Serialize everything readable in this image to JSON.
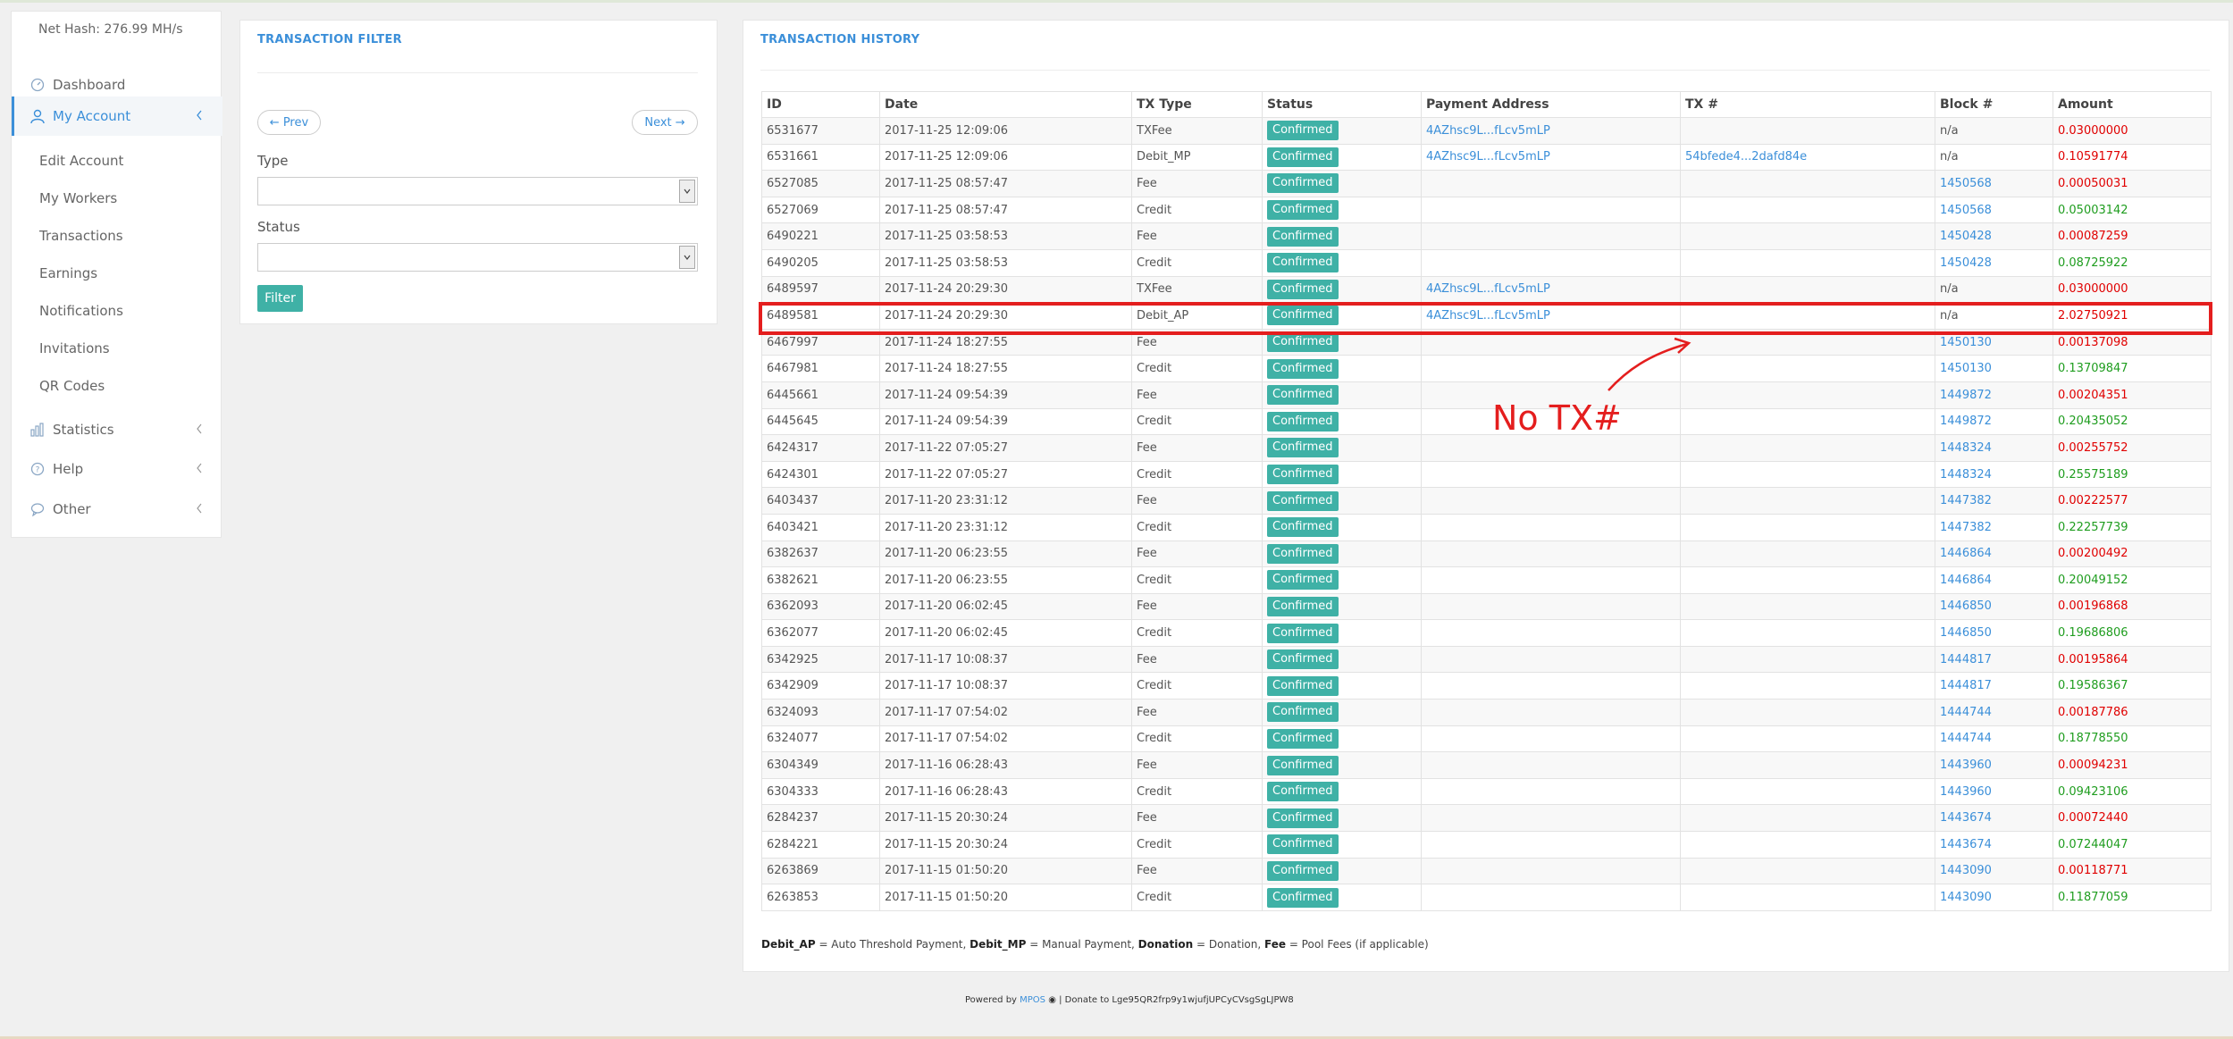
{
  "sidebar": {
    "net_hash": "Net Hash: 276.99 MH/s",
    "dashboard": "Dashboard",
    "my_account": "My Account",
    "sub_items": [
      "Edit Account",
      "My Workers",
      "Transactions",
      "Earnings",
      "Notifications",
      "Invitations",
      "QR Codes"
    ],
    "statistics": "Statistics",
    "help": "Help",
    "other": "Other"
  },
  "filter": {
    "title": "TRANSACTION FILTER",
    "prev": "← Prev",
    "next": "Next →",
    "type_label": "Type",
    "status_label": "Status",
    "filter_button": "Filter"
  },
  "history": {
    "title": "TRANSACTION HISTORY",
    "columns": [
      "ID",
      "Date",
      "TX Type",
      "Status",
      "Payment Address",
      "TX #",
      "Block #",
      "Amount"
    ],
    "rows": [
      {
        "id": "6531677",
        "date": "2017-11-25 12:09:06",
        "type": "TXFee",
        "status": "Confirmed",
        "address": "4AZhsc9L...fLcv5mLP",
        "tx": "",
        "block": "n/a",
        "amount": "0.03000000",
        "sign": "neg"
      },
      {
        "id": "6531661",
        "date": "2017-11-25 12:09:06",
        "type": "Debit_MP",
        "status": "Confirmed",
        "address": "4AZhsc9L...fLcv5mLP",
        "tx": "54bfede4...2dafd84e",
        "block": "n/a",
        "amount": "0.10591774",
        "sign": "neg"
      },
      {
        "id": "6527085",
        "date": "2017-11-25 08:57:47",
        "type": "Fee",
        "status": "Confirmed",
        "address": "",
        "tx": "",
        "block": "1450568",
        "amount": "0.00050031",
        "sign": "neg"
      },
      {
        "id": "6527069",
        "date": "2017-11-25 08:57:47",
        "type": "Credit",
        "status": "Confirmed",
        "address": "",
        "tx": "",
        "block": "1450568",
        "amount": "0.05003142",
        "sign": "pos"
      },
      {
        "id": "6490221",
        "date": "2017-11-25 03:58:53",
        "type": "Fee",
        "status": "Confirmed",
        "address": "",
        "tx": "",
        "block": "1450428",
        "amount": "0.00087259",
        "sign": "neg"
      },
      {
        "id": "6490205",
        "date": "2017-11-25 03:58:53",
        "type": "Credit",
        "status": "Confirmed",
        "address": "",
        "tx": "",
        "block": "1450428",
        "amount": "0.08725922",
        "sign": "pos"
      },
      {
        "id": "6489597",
        "date": "2017-11-24 20:29:30",
        "type": "TXFee",
        "status": "Confirmed",
        "address": "4AZhsc9L...fLcv5mLP",
        "tx": "",
        "block": "n/a",
        "amount": "0.03000000",
        "sign": "neg"
      },
      {
        "id": "6489581",
        "date": "2017-11-24 20:29:30",
        "type": "Debit_AP",
        "status": "Confirmed",
        "address": "4AZhsc9L...fLcv5mLP",
        "tx": "",
        "block": "n/a",
        "amount": "2.02750921",
        "sign": "neg"
      },
      {
        "id": "6467997",
        "date": "2017-11-24 18:27:55",
        "type": "Fee",
        "status": "Confirmed",
        "address": "",
        "tx": "",
        "block": "1450130",
        "amount": "0.00137098",
        "sign": "neg"
      },
      {
        "id": "6467981",
        "date": "2017-11-24 18:27:55",
        "type": "Credit",
        "status": "Confirmed",
        "address": "",
        "tx": "",
        "block": "1450130",
        "amount": "0.13709847",
        "sign": "pos"
      },
      {
        "id": "6445661",
        "date": "2017-11-24 09:54:39",
        "type": "Fee",
        "status": "Confirmed",
        "address": "",
        "tx": "",
        "block": "1449872",
        "amount": "0.00204351",
        "sign": "neg"
      },
      {
        "id": "6445645",
        "date": "2017-11-24 09:54:39",
        "type": "Credit",
        "status": "Confirmed",
        "address": "",
        "tx": "",
        "block": "1449872",
        "amount": "0.20435052",
        "sign": "pos"
      },
      {
        "id": "6424317",
        "date": "2017-11-22 07:05:27",
        "type": "Fee",
        "status": "Confirmed",
        "address": "",
        "tx": "",
        "block": "1448324",
        "amount": "0.00255752",
        "sign": "neg"
      },
      {
        "id": "6424301",
        "date": "2017-11-22 07:05:27",
        "type": "Credit",
        "status": "Confirmed",
        "address": "",
        "tx": "",
        "block": "1448324",
        "amount": "0.25575189",
        "sign": "pos"
      },
      {
        "id": "6403437",
        "date": "2017-11-20 23:31:12",
        "type": "Fee",
        "status": "Confirmed",
        "address": "",
        "tx": "",
        "block": "1447382",
        "amount": "0.00222577",
        "sign": "neg"
      },
      {
        "id": "6403421",
        "date": "2017-11-20 23:31:12",
        "type": "Credit",
        "status": "Confirmed",
        "address": "",
        "tx": "",
        "block": "1447382",
        "amount": "0.22257739",
        "sign": "pos"
      },
      {
        "id": "6382637",
        "date": "2017-11-20 06:23:55",
        "type": "Fee",
        "status": "Confirmed",
        "address": "",
        "tx": "",
        "block": "1446864",
        "amount": "0.00200492",
        "sign": "neg"
      },
      {
        "id": "6382621",
        "date": "2017-11-20 06:23:55",
        "type": "Credit",
        "status": "Confirmed",
        "address": "",
        "tx": "",
        "block": "1446864",
        "amount": "0.20049152",
        "sign": "pos"
      },
      {
        "id": "6362093",
        "date": "2017-11-20 06:02:45",
        "type": "Fee",
        "status": "Confirmed",
        "address": "",
        "tx": "",
        "block": "1446850",
        "amount": "0.00196868",
        "sign": "neg"
      },
      {
        "id": "6362077",
        "date": "2017-11-20 06:02:45",
        "type": "Credit",
        "status": "Confirmed",
        "address": "",
        "tx": "",
        "block": "1446850",
        "amount": "0.19686806",
        "sign": "pos"
      },
      {
        "id": "6342925",
        "date": "2017-11-17 10:08:37",
        "type": "Fee",
        "status": "Confirmed",
        "address": "",
        "tx": "",
        "block": "1444817",
        "amount": "0.00195864",
        "sign": "neg"
      },
      {
        "id": "6342909",
        "date": "2017-11-17 10:08:37",
        "type": "Credit",
        "status": "Confirmed",
        "address": "",
        "tx": "",
        "block": "1444817",
        "amount": "0.19586367",
        "sign": "pos"
      },
      {
        "id": "6324093",
        "date": "2017-11-17 07:54:02",
        "type": "Fee",
        "status": "Confirmed",
        "address": "",
        "tx": "",
        "block": "1444744",
        "amount": "0.00187786",
        "sign": "neg"
      },
      {
        "id": "6324077",
        "date": "2017-11-17 07:54:02",
        "type": "Credit",
        "status": "Confirmed",
        "address": "",
        "tx": "",
        "block": "1444744",
        "amount": "0.18778550",
        "sign": "pos"
      },
      {
        "id": "6304349",
        "date": "2017-11-16 06:28:43",
        "type": "Fee",
        "status": "Confirmed",
        "address": "",
        "tx": "",
        "block": "1443960",
        "amount": "0.00094231",
        "sign": "neg"
      },
      {
        "id": "6304333",
        "date": "2017-11-16 06:28:43",
        "type": "Credit",
        "status": "Confirmed",
        "address": "",
        "tx": "",
        "block": "1443960",
        "amount": "0.09423106",
        "sign": "pos"
      },
      {
        "id": "6284237",
        "date": "2017-11-15 20:30:24",
        "type": "Fee",
        "status": "Confirmed",
        "address": "",
        "tx": "",
        "block": "1443674",
        "amount": "0.00072440",
        "sign": "neg"
      },
      {
        "id": "6284221",
        "date": "2017-11-15 20:30:24",
        "type": "Credit",
        "status": "Confirmed",
        "address": "",
        "tx": "",
        "block": "1443674",
        "amount": "0.07244047",
        "sign": "pos"
      },
      {
        "id": "6263869",
        "date": "2017-11-15 01:50:20",
        "type": "Fee",
        "status": "Confirmed",
        "address": "",
        "tx": "",
        "block": "1443090",
        "amount": "0.00118771",
        "sign": "neg"
      },
      {
        "id": "6263853",
        "date": "2017-11-15 01:50:20",
        "type": "Credit",
        "status": "Confirmed",
        "address": "",
        "tx": "",
        "block": "1443090",
        "amount": "0.11877059",
        "sign": "pos"
      }
    ],
    "legend": [
      {
        "key": "Debit_AP",
        "desc": " = Auto Threshold Payment, "
      },
      {
        "key": "Debit_MP",
        "desc": " = Manual Payment, "
      },
      {
        "key": "Donation",
        "desc": " = Donation, "
      },
      {
        "key": "Fee",
        "desc": " = Pool Fees (if applicable)"
      }
    ]
  },
  "annotation": {
    "text": "No TX#",
    "color": "#e41e1e"
  },
  "footer": {
    "powered_by": "Powered by ",
    "mpos": "MPOS",
    "donate": " | Donate to Lge95QR2frp9y1wjufjUPCyCVsgSgLJPW8"
  },
  "colors": {
    "accent": "#3b8fd9",
    "badge": "#3fb1a6",
    "positive": "#1f9d1f",
    "negative": "#e00000"
  }
}
